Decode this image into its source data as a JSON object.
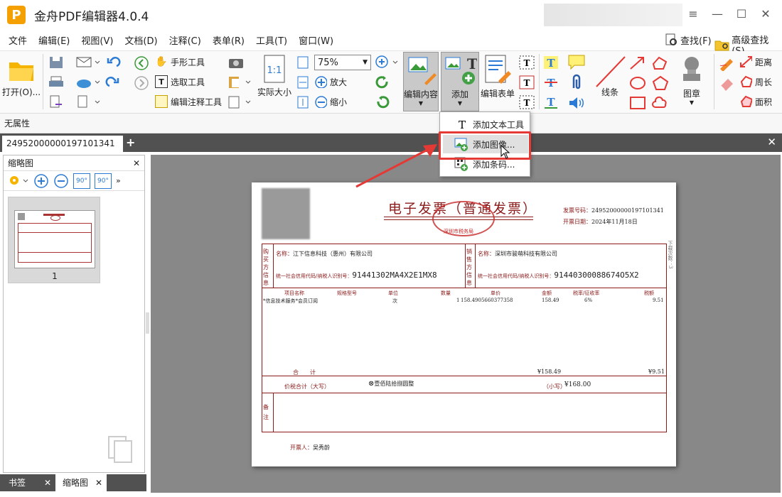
{
  "window": {
    "title": "金舟PDF编辑器4.0.4",
    "logo_letter": "P",
    "controls": [
      "≡",
      "—",
      "☐",
      "✕"
    ]
  },
  "menu": [
    "文件",
    "编辑(E)",
    "视图(V)",
    "文档(D)",
    "注释(C)",
    "表单(R)",
    "工具(T)",
    "窗口(W)"
  ],
  "menu_right": {
    "find": "查找(F)",
    "advanced_find": "高级查找(S)"
  },
  "ribbon": {
    "open": "打开(O)...",
    "hand_tool": "手形工具",
    "select_tool": "选取工具",
    "edit_annot_tool": "编辑注释工具",
    "actual_size": "实际大小",
    "zoom_value": "75%",
    "zoom_in": "放大",
    "zoom_out": "缩小",
    "edit_content": "编辑内容",
    "add": "添加",
    "edit_form": "编辑表单",
    "line": "线条",
    "stamp": "图章",
    "distance": "距离",
    "perimeter": "周长",
    "area": "面积"
  },
  "properties": "无属性",
  "tab": {
    "name": "24952000000197101341"
  },
  "dropdown": [
    {
      "label": "添加文本工具",
      "icon": "text-tool-icon"
    },
    {
      "label": "添加图像...",
      "icon": "add-image-icon"
    },
    {
      "label": "添加条码...",
      "icon": "barcode-icon"
    }
  ],
  "thumbnail_panel": {
    "title": "缩略图",
    "page_number": "1",
    "rotate_left": "90°",
    "rotate_right": "90°"
  },
  "bottom_tabs": [
    "书签",
    "缩略图"
  ],
  "invoice": {
    "title": "电子发票（普通发票）",
    "seal_text": "深圳市税务局",
    "invoice_no_label": "发票号码：",
    "invoice_no": "24952000000197101341",
    "date_label": "开票日期：",
    "date": "2024年11月18日",
    "buyer_side": "购买方信息",
    "seller_side": "销售方信息",
    "buyer_name_label": "名称：",
    "buyer_name": "江下信息科技（惠州）有限公司",
    "buyer_tax_label": "统一社会信用代码/纳税人识别号：",
    "buyer_tax": "91441302MA4X2E1MX8",
    "seller_name_label": "名称：",
    "seller_name": "深圳市骏萌科技有限公司",
    "seller_tax_label": "统一社会信用代码/纳税人识别号：",
    "seller_tax": "91440300088674O5X2",
    "columns": [
      "项目名称",
      "规格型号",
      "单位",
      "数量",
      "单价",
      "金额",
      "税率/征收率",
      "税额"
    ],
    "row": {
      "name": "*信息技术服务*会员订阅",
      "unit": "次",
      "qty": "1",
      "price": "158.4905660377358",
      "amount": "158.49",
      "rate": "6%",
      "tax": "9.51"
    },
    "total_label": "合　　计",
    "total_amount": "¥158.49",
    "total_tax": "¥9.51",
    "grand_label": "价税合计（大写）",
    "grand_upper": "壹佰陆拾捌圆整",
    "grand_small_label": "（小写）",
    "grand_small": "¥168.00",
    "remark_label": "备注",
    "drawer_label": "开票人：",
    "drawer": "吴秀龄",
    "side_note": "下载次数：3"
  },
  "colors": {
    "accent": "#e53935",
    "invoice": "#8b1a1a",
    "tabstrip": "#515151",
    "viewer_bg": "#888888"
  }
}
